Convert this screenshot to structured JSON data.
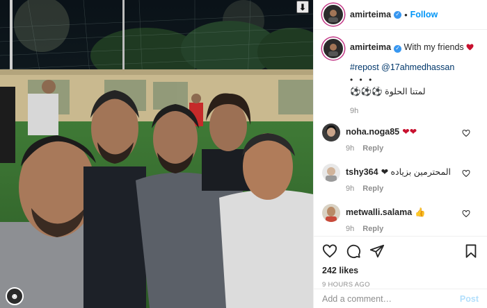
{
  "photo": {
    "download_glyph": "⬇",
    "profile_glyph": "☻"
  },
  "header": {
    "username": "amirteima",
    "verified_glyph": "✓",
    "separator": "•",
    "follow_label": "Follow"
  },
  "caption": {
    "username": "amirteima",
    "text": "With my friends",
    "hashtags": "#repost @17ahmedhassan",
    "dots": "• • •",
    "arabic_text": "لمتنا الحلوة ⚽⚽⚽",
    "time": "9h"
  },
  "comments": [
    {
      "username": "noha.noga85",
      "text": "❤❤",
      "time": "9h",
      "reply": "Reply"
    },
    {
      "username": "tshy364",
      "text": "المحترمين بزياده ❤",
      "time": "9h",
      "reply": "Reply"
    },
    {
      "username": "metwalli.salama",
      "text": "👍",
      "time": "9h",
      "reply": "Reply"
    }
  ],
  "actions": {
    "likes": "242 likes",
    "time_ago": "9 HOURS AGO"
  },
  "add_comment": {
    "placeholder": "Add a comment…",
    "post_label": "Post"
  },
  "colors": {
    "accent": "#0095f6",
    "heart": "#ed4956",
    "verified": "#3897f0",
    "muted": "#8e8e8e"
  }
}
